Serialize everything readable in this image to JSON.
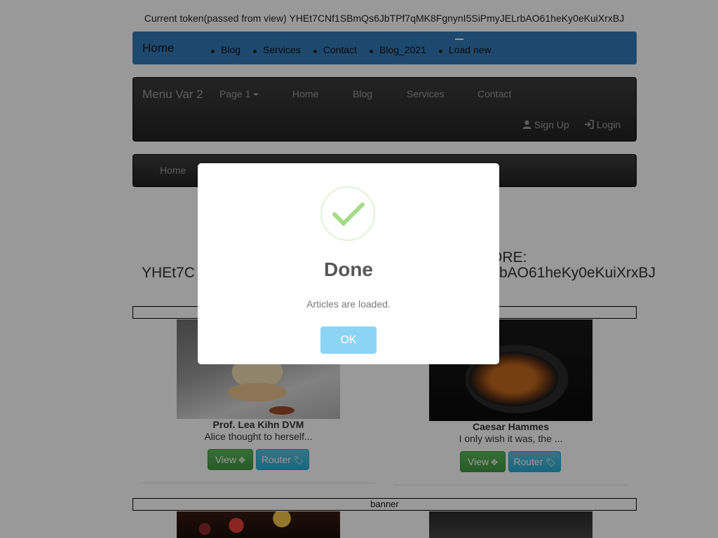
{
  "token_line": "Current token(passed from view) YHEt7CNf1SBmQs6JbTPf7qMK8FgnynI5SiPmyJELrbAO61heKy0eKuiXrxBJ",
  "blue_nav": {
    "brand": "Home",
    "items": [
      "Blog",
      "Services",
      "Contact",
      "Blog_2021",
      "Load new"
    ],
    "bg_color": "#337ab7"
  },
  "dark_nav": {
    "brand": "Menu Var 2",
    "dropdown": "Page 1",
    "links": [
      "Home",
      "Blog",
      "Services",
      "Contact"
    ],
    "signup": "Sign Up",
    "login": "Login"
  },
  "nav3": {
    "home": "Home"
  },
  "background_text": {
    "left": "YHEt7C",
    "right_line1": "ORE:",
    "right_line2": "bAO61heKy0eKuiXrxBJ"
  },
  "banner_label": "banner",
  "cards": [
    {
      "title": "Prof. Lea Kihn DVM",
      "excerpt": "Alice thought to herself...",
      "view": "View",
      "router": "Router"
    },
    {
      "title": "Caesar Hammes",
      "excerpt": "I only wish it was, the ...",
      "view": "View",
      "router": "Router"
    }
  ],
  "modal": {
    "title": "Done",
    "text": "Articles are loaded.",
    "ok": "OK",
    "icon": "success-check-icon",
    "accent_color": "#a5dc86",
    "button_color": "#8cd4f5"
  }
}
